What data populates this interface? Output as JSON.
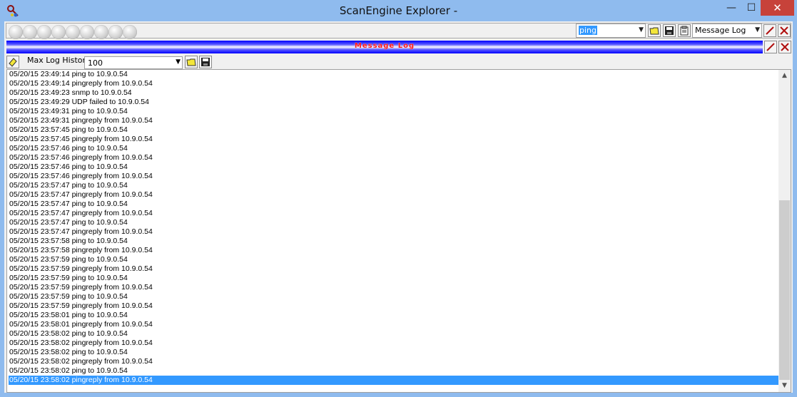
{
  "window": {
    "title": "ScanEngine Explorer -",
    "minimize_glyph": "—",
    "maximize_glyph": "☐",
    "close_glyph": "✕"
  },
  "toolbar": {
    "command_combo_value": "ping",
    "view_combo_value": "Message Log",
    "status_lights_count": 9
  },
  "log_panel": {
    "header_title": "Message Log",
    "max_history_label": "Max Log History",
    "max_history_value": "100"
  },
  "icons": {
    "app": "key-scanner-icon",
    "open": "folder-open-icon",
    "save": "floppy-save-icon",
    "clipboard": "clipboard-icon",
    "edit": "pencil-edit-icon",
    "close": "red-x-close-icon",
    "clear": "eraser-icon"
  },
  "colors": {
    "titlebar": "#8fbbee",
    "header_bar": "#0000ff",
    "header_text": "#ff1a1a",
    "selection": "#3399ff"
  },
  "log_lines": [
    "05/20/15 23:49:14 ping to 10.9.0.54",
    "05/20/15 23:49:14 pingreply from 10.9.0.54",
    "05/20/15 23:49:23 snmp to 10.9.0.54",
    "05/20/15 23:49:29 UDP failed to 10.9.0.54",
    "05/20/15 23:49:31 ping to 10.9.0.54",
    "05/20/15 23:49:31 pingreply from 10.9.0.54",
    "05/20/15 23:57:45 ping to 10.9.0.54",
    "05/20/15 23:57:45 pingreply from 10.9.0.54",
    "05/20/15 23:57:46 ping to 10.9.0.54",
    "05/20/15 23:57:46 pingreply from 10.9.0.54",
    "05/20/15 23:57:46 ping to 10.9.0.54",
    "05/20/15 23:57:46 pingreply from 10.9.0.54",
    "05/20/15 23:57:47 ping to 10.9.0.54",
    "05/20/15 23:57:47 pingreply from 10.9.0.54",
    "05/20/15 23:57:47 ping to 10.9.0.54",
    "05/20/15 23:57:47 pingreply from 10.9.0.54",
    "05/20/15 23:57:47 ping to 10.9.0.54",
    "05/20/15 23:57:47 pingreply from 10.9.0.54",
    "05/20/15 23:57:58 ping to 10.9.0.54",
    "05/20/15 23:57:58 pingreply from 10.9.0.54",
    "05/20/15 23:57:59 ping to 10.9.0.54",
    "05/20/15 23:57:59 pingreply from 10.9.0.54",
    "05/20/15 23:57:59 ping to 10.9.0.54",
    "05/20/15 23:57:59 pingreply from 10.9.0.54",
    "05/20/15 23:57:59 ping to 10.9.0.54",
    "05/20/15 23:57:59 pingreply from 10.9.0.54",
    "05/20/15 23:58:01 ping to 10.9.0.54",
    "05/20/15 23:58:01 pingreply from 10.9.0.54",
    "05/20/15 23:58:02 ping to 10.9.0.54",
    "05/20/15 23:58:02 pingreply from 10.9.0.54",
    "05/20/15 23:58:02 ping to 10.9.0.54",
    "05/20/15 23:58:02 pingreply from 10.9.0.54",
    "05/20/15 23:58:02 ping to 10.9.0.54",
    "05/20/15 23:58:02 pingreply from 10.9.0.54"
  ],
  "selected_line_index": 33
}
